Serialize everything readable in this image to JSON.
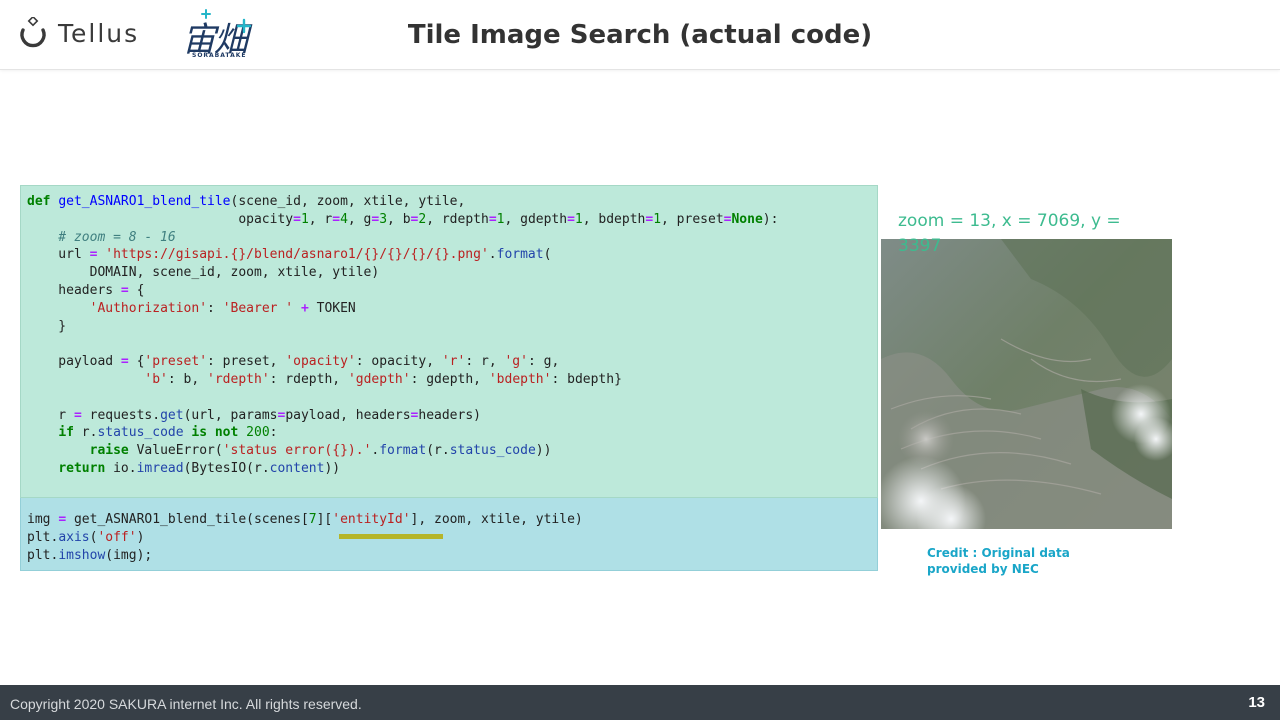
{
  "header": {
    "logo_tellus": "Tellus",
    "logo_sora_kanji": "宙畑",
    "logo_sora_latin": "SORABATAKE",
    "title": "Tile Image Search (actual code)"
  },
  "code": {
    "definition_lines": [
      "def get_ASNARO1_blend_tile(scene_id, zoom, xtile, ytile,",
      "                           opacity=1, r=4, g=3, b=2, rdepth=1, gdepth=1, bdepth=1, preset=None):",
      "    # zoom = 8 - 16",
      "    url = 'https://gisapi.{}/blend/asnaro1/{}/{}/{}/{}.png'.format(",
      "        DOMAIN, scene_id, zoom, xtile, ytile)",
      "    headers = {",
      "        'Authorization': 'Bearer ' + TOKEN",
      "    }",
      "",
      "    payload = {'preset': preset, 'opacity': opacity, 'r': r, 'g': g,",
      "               'b': b, 'rdepth': rdepth, 'gdepth': gdepth, 'bdepth': bdepth}",
      "",
      "    r = requests.get(url, params=payload, headers=headers)",
      "    if r.status_code is not 200:",
      "        raise ValueError('status error({}).'.format(r.status_code))",
      "    return io.imread(BytesIO(r.content))"
    ],
    "call_lines": [
      "img = get_ASNARO1_blend_tile(scenes[7]['entityId'], zoom, xtile, ytile)",
      "plt.axis('off')",
      "plt.imshow(img);"
    ],
    "highlight_text": "'entityId'"
  },
  "image_panel": {
    "caption": "zoom = 13, x = 7069, y = 3397",
    "image_icon": "satellite-image",
    "credit_line1": "Credit : Original data",
    "credit_line2": "provided by NEC"
  },
  "footer": {
    "copyright": "Copyright 2020 SAKURA  internet Inc.  All rights reserved.",
    "page_number": "13"
  },
  "colors": {
    "definition_bg": "#bde9da",
    "call_bg": "#afe0e6",
    "caption": "#3dbb8f",
    "credit": "#1aa6c8",
    "highlight_underline": "#b5b52a",
    "footer_bg": "#373f47"
  }
}
